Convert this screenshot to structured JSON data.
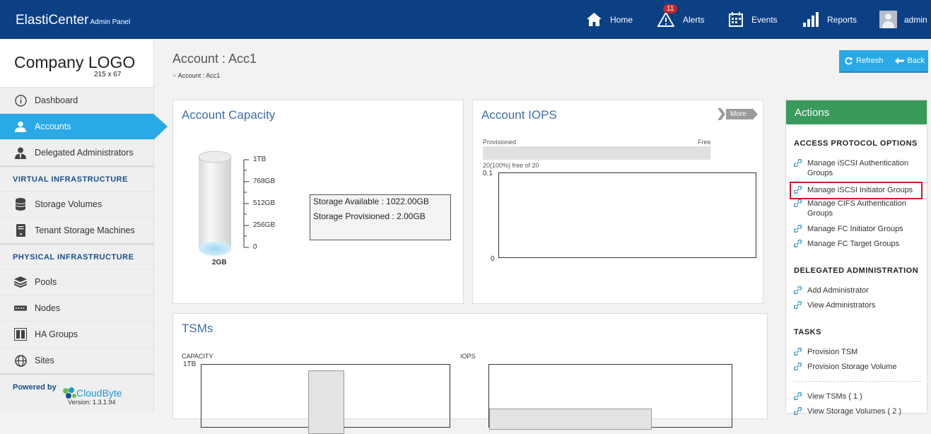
{
  "header": {
    "brand": "ElastiCenter",
    "brand_sub": "Admin Panel",
    "home": "Home",
    "alerts": "Alerts",
    "alerts_count": "11",
    "events": "Events",
    "reports": "Reports",
    "user": "admin"
  },
  "sidebar": {
    "logo": "Company LOGO",
    "logo_size": "215 x 67",
    "items": [
      {
        "label": "Dashboard",
        "icon": "info-icon"
      },
      {
        "label": "Accounts",
        "icon": "user-icon",
        "active": true
      },
      {
        "label": "Delegated Administrators",
        "icon": "admin-user-icon"
      }
    ],
    "section_virtual": "VIRTUAL INFRASTRUCTURE",
    "virtual_items": [
      {
        "label": "Storage Volumes",
        "icon": "database-icon"
      },
      {
        "label": "Tenant Storage Machines",
        "icon": "server-icon"
      }
    ],
    "section_physical": "PHYSICAL INFRASTRUCTURE",
    "physical_items": [
      {
        "label": "Pools",
        "icon": "layers-icon"
      },
      {
        "label": "Nodes",
        "icon": "nodes-icon"
      },
      {
        "label": "HA Groups",
        "icon": "ha-groups-icon"
      },
      {
        "label": "Sites",
        "icon": "globe-icon"
      }
    ],
    "powered_by": "Powered by",
    "brand_logo": "CloudByte",
    "version": "Version: 1.3.1.94"
  },
  "page": {
    "title": "Account : Acc1",
    "breadcrumb": "Account : Acc1",
    "refresh": "Refresh",
    "back": "Back"
  },
  "capacity": {
    "title": "Account Capacity",
    "ticks": [
      "1TB",
      "768GB",
      "512GB",
      "256GB",
      "0"
    ],
    "cylinder_label": "2GB",
    "fill_fraction": 0.002,
    "available": "Storage Available : 1022.00GB",
    "provisioned": "Storage Provisioned : 2.00GB"
  },
  "iops": {
    "title": "Account IOPS",
    "more": "More",
    "provisioned_label": "Provisioned",
    "free_label": "Free",
    "free_text": "20(100%) free of 20",
    "y_top": "0.1",
    "y_bottom": "0"
  },
  "tsms": {
    "title": "TSMs",
    "capacity_label": "CAPACITY",
    "capacity_tick": "1TB",
    "iops_label": "IOPS"
  },
  "actions": {
    "title": "Actions",
    "access_header": "ACCESS PROTOCOL OPTIONS",
    "access_links": [
      "Manage iSCSI Authentication Groups",
      "Manage iSCSI Initiator Groups",
      "Manage CIFS Authentication Groups",
      "Manage FC Initiator Groups",
      "Manage FC Target Groups"
    ],
    "delegated_header": "DELEGATED ADMINISTRATION",
    "delegated_links": [
      "Add Administrator",
      "View Administrators"
    ],
    "tasks_header": "TASKS",
    "task_links": [
      "Provision TSM",
      "Provision Storage Volume"
    ],
    "view_links": [
      "View TSMs ( 1 )",
      "View Storage Volumes ( 2 )"
    ]
  },
  "colors": {
    "topbar": "#0b4085",
    "accent": "#29a9e6",
    "actions_header": "#3a9a5b",
    "highlight": "#d21d23"
  }
}
